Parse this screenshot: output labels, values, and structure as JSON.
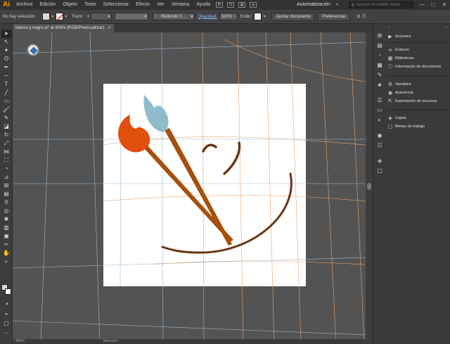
{
  "app": {
    "logo": "Ai"
  },
  "menu": [
    "Archivo",
    "Edición",
    "Objeto",
    "Texto",
    "Seleccionar",
    "Efecto",
    "Ver",
    "Ventana",
    "Ayuda"
  ],
  "menubar_icons": {
    "br": "Br",
    "st": "St"
  },
  "workspace": {
    "label": "Automatización"
  },
  "search": {
    "placeholder": "Buscar en Adobe Stock"
  },
  "window_controls": {
    "minimize": "—",
    "maximize": "□",
    "close": "✕"
  },
  "controlbar": {
    "selection_label": "No hay selección",
    "stroke_label": "Trazo:",
    "brush_label": "Redondo 3 ...",
    "opacity_label": "Opacidad:",
    "opacity_value": "100%",
    "style_label": "Estilo:",
    "adjust_button": "Ajustar documento",
    "preferences_button": "Preferencias",
    "fill_color": "#e8d7cd"
  },
  "document": {
    "tab_title": "blanco y negro.ai* al 400% (RGB/Previsualizar)",
    "close": "✕"
  },
  "statusbar": {
    "zoom": "400%",
    "info": "Selección"
  },
  "panels": [
    {
      "label": "Acciones",
      "icon": "▶"
    },
    {
      "label": "Enlaces",
      "icon": "∞"
    },
    {
      "label": "Bibliotecas",
      "icon": "▦"
    },
    {
      "label": "Información de documento",
      "icon": "ⓘ"
    },
    {
      "label": "Variables",
      "icon": "⚙"
    },
    {
      "label": "Apariencia",
      "icon": "◉"
    },
    {
      "label": "Exportación de recursos",
      "icon": "⇱"
    },
    {
      "label": "Capas",
      "icon": "◈"
    },
    {
      "label": "Mesas de trabajo",
      "icon": "▢"
    }
  ],
  "colors": {
    "paintbrush_left_tip": "#e04f0e",
    "paintbrush_right_tip": "#8fbccc",
    "handle": "#a64f0c",
    "smile": "#6a3412",
    "guide_blue": "#9cbad6",
    "guide_orange": "#e7a472"
  }
}
